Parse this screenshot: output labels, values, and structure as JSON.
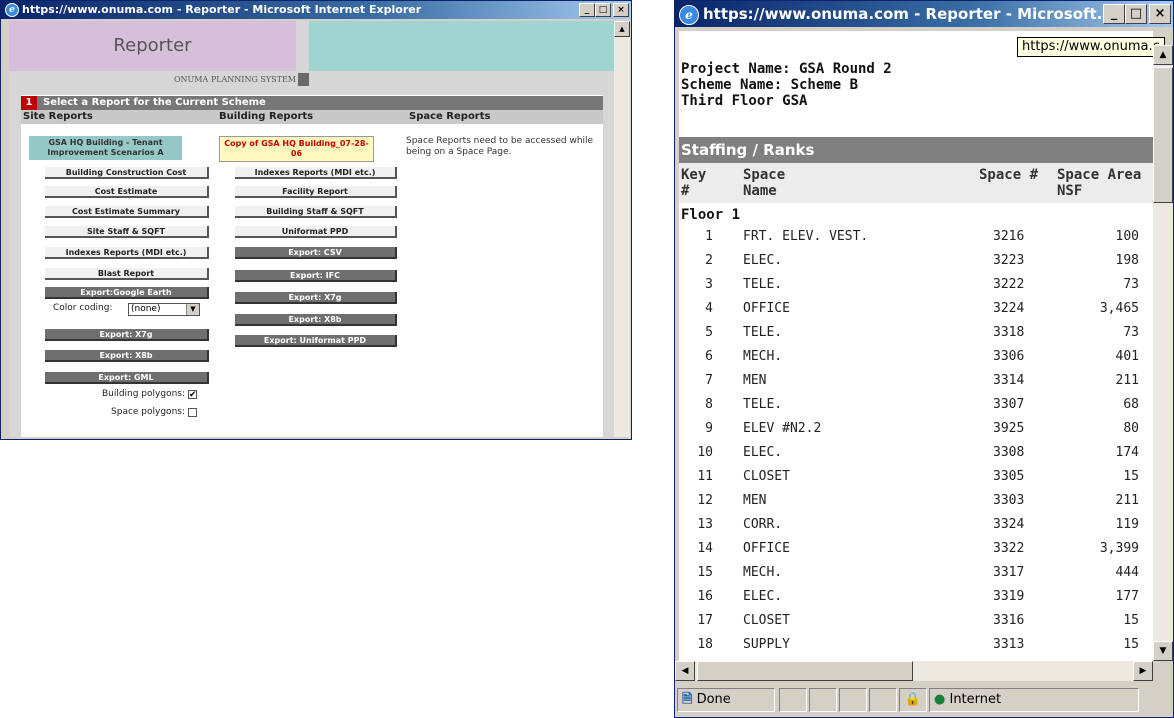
{
  "left_window": {
    "title": "https://www.onuma.com - Reporter - Microsoft Internet Explorer",
    "controls": [
      "_",
      "□",
      "×"
    ],
    "banner": {
      "title": "Reporter",
      "subtitle": "ONUMA PLANNING SYSTEM"
    },
    "panel": {
      "step_number": "1",
      "heading": "Select a Report for the Current Scheme",
      "columns": {
        "site": "Site Reports",
        "building": "Building Reports",
        "space": "Space Reports"
      },
      "site_reports": {
        "scheme": "GSA HQ Building - Tenant Improvement Scenarios A",
        "buttons": [
          "Building Construction Cost",
          "Cost Estimate",
          "Cost Estimate Summary",
          "Site Staff & SQFT",
          "Indexes Reports (MDI etc.)",
          "Blast Report"
        ],
        "export_google_earth": "Export:Google Earth",
        "color_coding_label": "Color coding:",
        "color_coding_value": "(none)",
        "exports": [
          "Export: X7g",
          "Export: X8b",
          "Export: GML"
        ],
        "building_polygons_label": "Building polygons:",
        "building_polygons_checked": true,
        "space_polygons_label": "Space polygons:",
        "space_polygons_checked": false
      },
      "building_reports": {
        "scheme": "Copy of GSA HQ Building_07-28-06",
        "buttons": [
          "Indexes Reports (MDI etc.)",
          "Facility Report",
          "Building Staff & SQFT",
          "Uniformat PPD"
        ],
        "exports": [
          "Export: CSV",
          "Export: IFC",
          "Export: X7g",
          "Export: X8b",
          "Export: Uniformat PPD"
        ]
      },
      "space_reports": {
        "note": "Space Reports need to be accessed while being on a Space Page."
      }
    }
  },
  "right_window": {
    "title": "https://www.onuma.com - Reporter - Microsoft...",
    "controls": [
      "_",
      "□",
      "×"
    ],
    "tooltip": "https://www.onuma.c",
    "project_name": "Project Name: GSA Round 2",
    "scheme_name": "Scheme Name: Scheme B",
    "floor_name": "Third Floor GSA",
    "section_title": "Staffing / Ranks",
    "headers": {
      "key": "Key #",
      "name": "Space Name",
      "num": "Space #",
      "area": "Space Area NSF"
    },
    "group": "Floor 1",
    "rows": [
      {
        "key": "1",
        "name": "FRT. ELEV. VEST.",
        "num": "3216",
        "area": "100"
      },
      {
        "key": "2",
        "name": "ELEC.",
        "num": "3223",
        "area": "198"
      },
      {
        "key": "3",
        "name": "TELE.",
        "num": "3222",
        "area": "73"
      },
      {
        "key": "4",
        "name": "OFFICE",
        "num": "3224",
        "area": "3,465"
      },
      {
        "key": "5",
        "name": "TELE.",
        "num": "3318",
        "area": "73"
      },
      {
        "key": "6",
        "name": "MECH.",
        "num": "3306",
        "area": "401"
      },
      {
        "key": "7",
        "name": "MEN",
        "num": "3314",
        "area": "211"
      },
      {
        "key": "8",
        "name": "TELE.",
        "num": "3307",
        "area": "68"
      },
      {
        "key": "9",
        "name": "ELEV #N2.2",
        "num": "3925",
        "area": "80"
      },
      {
        "key": "10",
        "name": "ELEC.",
        "num": "3308",
        "area": "174"
      },
      {
        "key": "11",
        "name": "CLOSET",
        "num": "3305",
        "area": "15"
      },
      {
        "key": "12",
        "name": "MEN",
        "num": "3303",
        "area": "211"
      },
      {
        "key": "13",
        "name": "CORR.",
        "num": "3324",
        "area": "119"
      },
      {
        "key": "14",
        "name": "OFFICE",
        "num": "3322",
        "area": "3,399"
      },
      {
        "key": "15",
        "name": "MECH.",
        "num": "3317",
        "area": "444"
      },
      {
        "key": "16",
        "name": "ELEC.",
        "num": "3319",
        "area": "177"
      },
      {
        "key": "17",
        "name": "CLOSET",
        "num": "3316",
        "area": "15"
      },
      {
        "key": "18",
        "name": "SUPPLY",
        "num": "3313",
        "area": "15"
      }
    ],
    "status": {
      "text": "Done",
      "zone": "Internet"
    }
  },
  "colors": {
    "titlebar": "#0a246a",
    "banner_lavender": "#d7bfdc",
    "banner_teal": "#9fd4d0",
    "step_badge": "#c00000",
    "copy_scheme_text": "#cc0000"
  }
}
